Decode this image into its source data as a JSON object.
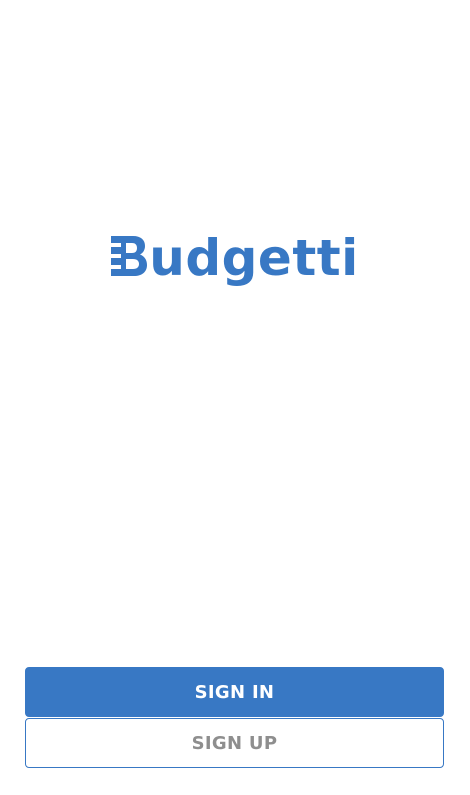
{
  "app": {
    "logo_text": "udgetti",
    "logo_full": "Budgetti",
    "brand_color": "#3878c4"
  },
  "actions": {
    "sign_in_label": "SIGN IN",
    "sign_up_label": "SIGN UP"
  },
  "colors": {
    "primary": "#3878c4",
    "secondary_text": "#8e8e8e",
    "background": "#ffffff"
  }
}
